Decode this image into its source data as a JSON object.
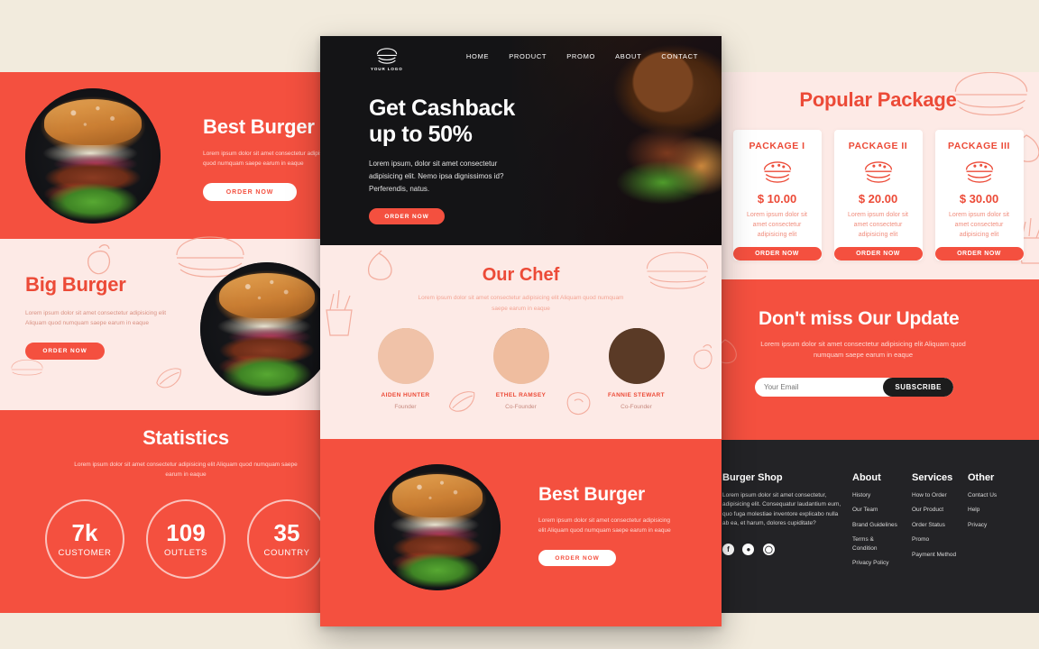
{
  "theme": {
    "page_bg": "#f2ebdd",
    "red": "#f4503f",
    "red_text": "#ec4a37",
    "pink": "#fdeae6",
    "dark": "#141416",
    "footer_dark": "#232326",
    "white": "#ffffff"
  },
  "front_panel": {
    "header": {
      "logo_text": "YOUR LOGO",
      "logo_icon": "burger-icon",
      "nav": [
        {
          "label": "HOME"
        },
        {
          "label": "PRODUCT"
        },
        {
          "label": "PROMO"
        },
        {
          "label": "ABOUT"
        },
        {
          "label": "CONTACT"
        }
      ]
    },
    "hero": {
      "title_line1": "Get Cashback",
      "title_line2": "up to 50%",
      "paragraph": "Lorem ipsum, dolor sit amet consectetur adipisicing elit. Nemo ipsa dignissimos id? Perferendis, natus.",
      "cta": "ORDER NOW"
    },
    "chef": {
      "heading": "Our Chef",
      "subtitle": "Lorem ipsum dolor sit amet consectetur adipisicing elit Aliquam quod numquam saepe earum in eaque",
      "members": [
        {
          "name": "AIDEN HUNTER",
          "role": "Founder"
        },
        {
          "name": "ETHEL RAMSEY",
          "role": "Co-Founder"
        },
        {
          "name": "FANNIE STEWART",
          "role": "Co-Founder"
        }
      ]
    },
    "best_burger": {
      "heading": "Best Burger",
      "paragraph": "Lorem ipsum dolor sit amet consectetur adipisicing elit Aliquam quod numquam saepe earum in eaque",
      "cta": "ORDER NOW"
    }
  },
  "back_page": {
    "best_burger": {
      "heading": "Best Burger",
      "paragraph": "Lorem ipsum dolor sit amet consectetur adipisicing Aliquam quod numquam saepe earum in eaque",
      "cta": "ORDER NOW"
    },
    "big_burger": {
      "heading": "Big Burger",
      "paragraph": "Lorem ipsum dolor sit amet consectetur adipisicing elit Aliquam quod numquam saepe earum in eaque",
      "cta": "ORDER NOW"
    },
    "statistics": {
      "heading": "Statistics",
      "subtitle": "Lorem ipsum dolor sit amet consectetur adipisicing elit Aliquam quod numquam saepe earum in eaque",
      "items": [
        {
          "value": "7k",
          "label": "CUSTOMER"
        },
        {
          "value": "109",
          "label": "OUTLETS"
        },
        {
          "value": "35",
          "label": "COUNTRY"
        }
      ]
    },
    "packages": {
      "heading": "Popular Package",
      "cards": [
        {
          "name": "PACKAGE I",
          "price": "$ 10.00",
          "desc": "Lorem ipsum dolor sit amet consectetur adipisicing elit",
          "cta": "ORDER NOW",
          "icon": "burger-icon"
        },
        {
          "name": "PACKAGE II",
          "price": "$ 20.00",
          "desc": "Lorem ipsum dolor sit amet consectetur adipisicing elit",
          "cta": "ORDER NOW",
          "icon": "burger-icon"
        },
        {
          "name": "PACKAGE III",
          "price": "$ 30.00",
          "desc": "Lorem ipsum dolor sit amet consectetur adipisicing elit",
          "cta": "ORDER NOW",
          "icon": "burger-icon"
        }
      ]
    },
    "newsletter": {
      "heading": "Don't miss Our Update",
      "subtitle": "Lorem ipsum dolor sit amet consectetur adipisicing elit Aliquam quod numquam saepe earum in eaque",
      "email_placeholder": "Your Email",
      "email_value": "",
      "submit_label": "SUBSCRIBE"
    },
    "footer": {
      "brand": "Burger Shop",
      "brand_text": "Lorem ipsum dolor sit amet consectetur, adipisicing elit. Consequatur laudantium eum, quo fuga molestiae inventore explicabo nulla ab ea, et harum, dolores cupiditate?",
      "social": [
        {
          "name": "facebook-icon",
          "glyph": "f"
        },
        {
          "name": "twitter-icon",
          "glyph": "ᴠ"
        },
        {
          "name": "whatsapp-icon",
          "glyph": "○"
        }
      ],
      "columns": [
        {
          "title": "About",
          "links": [
            "History",
            "Our Team",
            "Brand Guidelines",
            "Terms & Condition",
            "Privacy Policy"
          ]
        },
        {
          "title": "Services",
          "links": [
            "How to Order",
            "Our Product",
            "Order Status",
            "Promo",
            "Payment Method"
          ]
        },
        {
          "title": "Other",
          "links": [
            "Contact Us",
            "Help",
            "Privacy"
          ]
        }
      ]
    }
  }
}
